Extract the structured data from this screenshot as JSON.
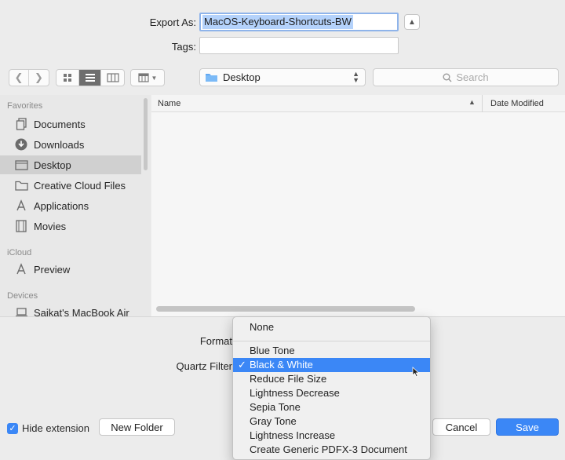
{
  "export_as": {
    "label": "Export As:",
    "value": "MacOS-Keyboard-Shortcuts-BW"
  },
  "tags": {
    "label": "Tags:",
    "value": ""
  },
  "toolbar": {
    "location": "Desktop",
    "search_placeholder": "Search"
  },
  "sidebar": {
    "favorites_header": "Favorites",
    "favorites": [
      {
        "label": "Documents",
        "icon": "documents-icon"
      },
      {
        "label": "Downloads",
        "icon": "downloads-icon"
      },
      {
        "label": "Desktop",
        "icon": "desktop-icon",
        "selected": true
      },
      {
        "label": "Creative Cloud Files",
        "icon": "folder-icon"
      },
      {
        "label": "Applications",
        "icon": "applications-icon"
      },
      {
        "label": "Movies",
        "icon": "movies-icon"
      }
    ],
    "icloud_header": "iCloud",
    "icloud": [
      {
        "label": "Preview",
        "icon": "applications-icon"
      }
    ],
    "devices_header": "Devices",
    "devices": [
      {
        "label": "Saikat's MacBook Air",
        "icon": "laptop-icon"
      }
    ]
  },
  "columns": {
    "name": "Name",
    "date_modified": "Date Modified"
  },
  "format": {
    "label": "Format"
  },
  "quartz_filter": {
    "label": "Quartz Filter",
    "options": [
      "None",
      "Blue Tone",
      "Black & White",
      "Reduce File Size",
      "Lightness Decrease",
      "Sepia Tone",
      "Gray Tone",
      "Lightness Increase",
      "Create Generic PDFX-3 Document"
    ],
    "selected": "Black & White",
    "check_glyph": "✓"
  },
  "footer": {
    "hide_extension": "Hide extension",
    "new_folder": "New Folder",
    "cancel": "Cancel",
    "save": "Save"
  },
  "colors": {
    "accent": "#3b87f6",
    "selection": "#b4d2fb"
  }
}
